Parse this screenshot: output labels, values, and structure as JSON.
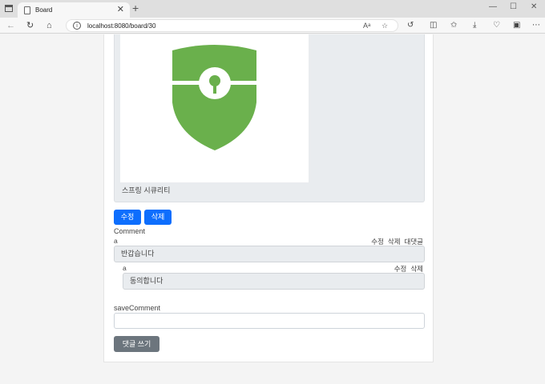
{
  "browser": {
    "tab_title": "Board",
    "tab_close": "✕",
    "new_tab": "+",
    "url": "localhost:8080/board/30",
    "win_minimize": "—",
    "win_maximize": "☐",
    "win_close": "✕"
  },
  "post": {
    "image_icon": "shield-key-icon",
    "image_color": "#6ab04c",
    "caption": "스프링 시큐리티",
    "edit_label": "수정",
    "delete_label": "삭제"
  },
  "comments": {
    "heading": "Comment",
    "items": [
      {
        "author": "a",
        "edit": "수정",
        "delete": "삭제",
        "reply": "대댓글",
        "text": "반갑습니다"
      },
      {
        "author": "a",
        "edit": "수정",
        "delete": "삭제",
        "text": "동의합니다"
      }
    ]
  },
  "save_comment": {
    "label": "saveComment",
    "value": "",
    "button_label": "댓글 쓰기"
  },
  "colors": {
    "primary": "#0d6efd",
    "secondary": "#6c757d",
    "shield": "#6ab04c"
  }
}
